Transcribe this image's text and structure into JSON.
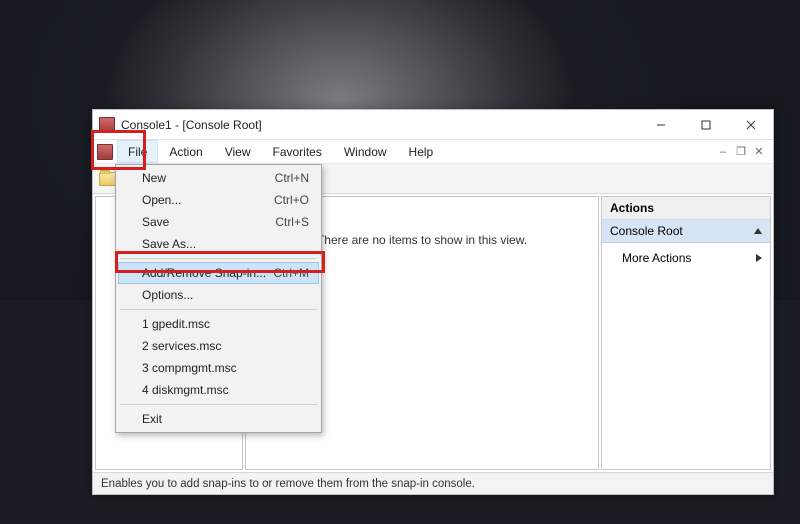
{
  "window": {
    "title": "Console1 - [Console Root]"
  },
  "menubar": {
    "items": [
      "File",
      "Action",
      "View",
      "Favorites",
      "Window",
      "Help"
    ]
  },
  "file_menu": {
    "new": {
      "label": "New",
      "shortcut": "Ctrl+N"
    },
    "open": {
      "label": "Open...",
      "shortcut": "Ctrl+O"
    },
    "save": {
      "label": "Save",
      "shortcut": "Ctrl+S"
    },
    "saveas": {
      "label": "Save As...",
      "shortcut": ""
    },
    "snapin": {
      "label": "Add/Remove Snap-in...",
      "shortcut": "Ctrl+M"
    },
    "options": {
      "label": "Options...",
      "shortcut": ""
    },
    "recent": [
      "1 gpedit.msc",
      "2 services.msc",
      "3 compmgmt.msc",
      "4 diskmgmt.msc"
    ],
    "exit": {
      "label": "Exit"
    }
  },
  "content": {
    "empty_text": "There are no items to show in this view."
  },
  "actions": {
    "header": "Actions",
    "root": "Console Root",
    "more": "More Actions"
  },
  "status": {
    "text": "Enables you to add snap-ins to or remove them from the snap-in console."
  }
}
